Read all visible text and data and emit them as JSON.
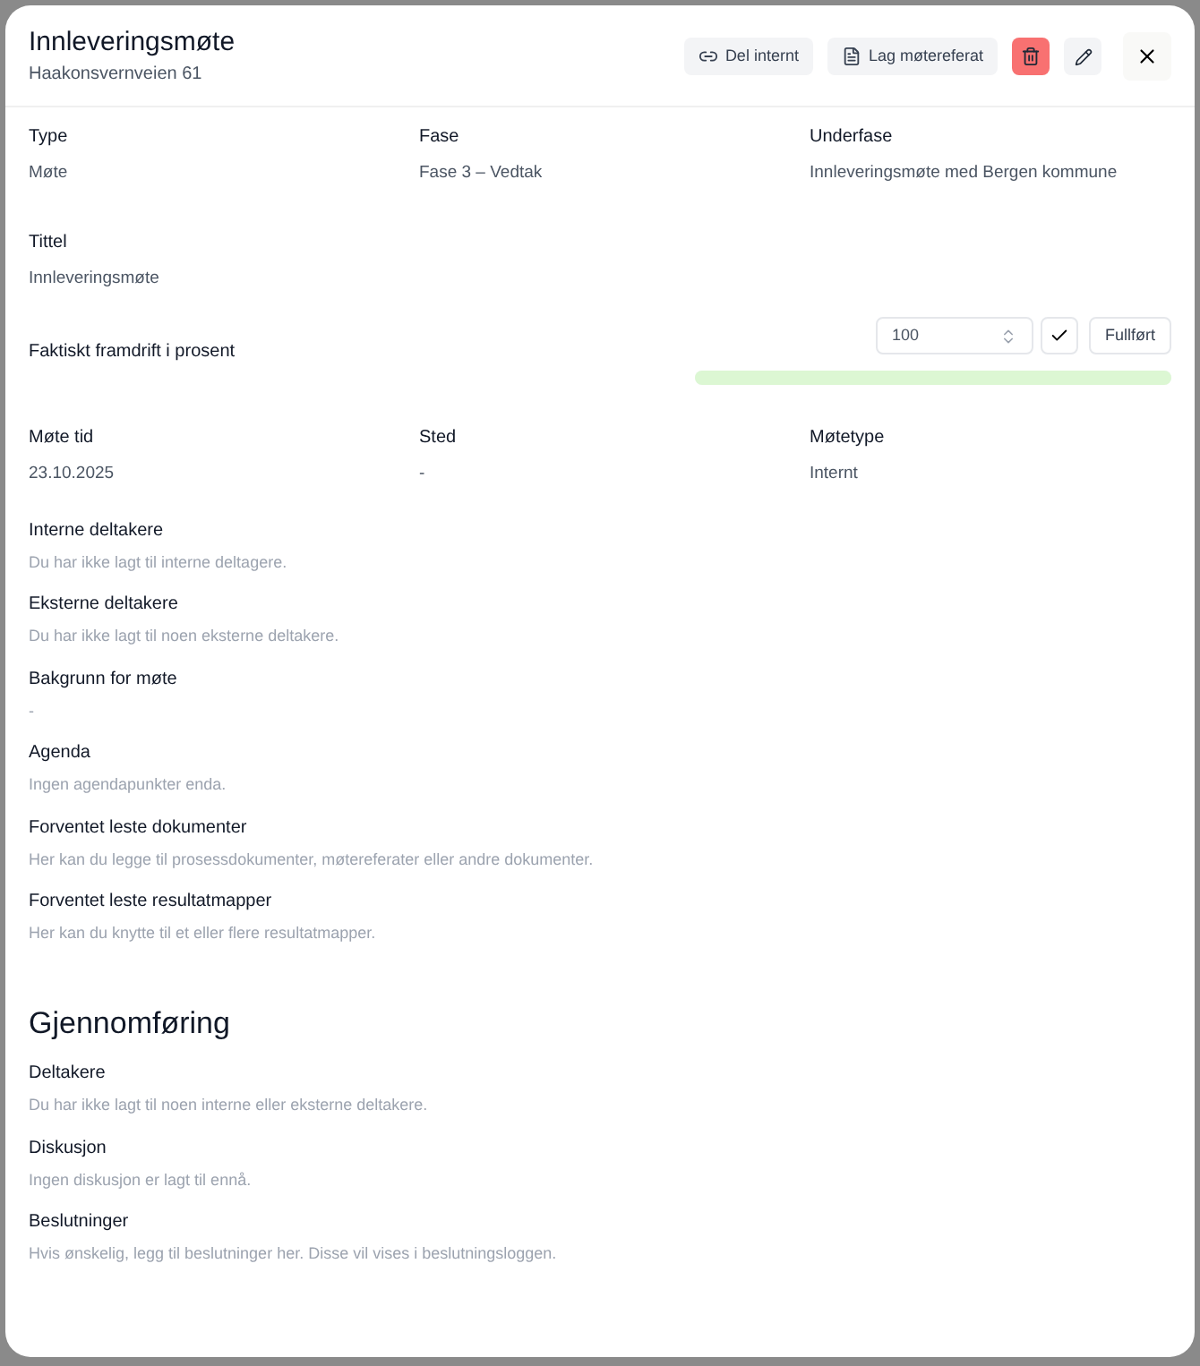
{
  "header": {
    "title": "Innleveringsmøte",
    "subtitle": "Haakonsvernveien 61"
  },
  "actions": [
    {
      "kind": "share",
      "label": "Del internt"
    },
    {
      "kind": "report",
      "label": "Lag møtereferat"
    },
    {
      "kind": "delete"
    },
    {
      "kind": "edit"
    },
    {
      "kind": "close"
    }
  ],
  "fields_top": [
    {
      "label": "Type",
      "value": "Møte"
    },
    {
      "label": "Fase",
      "value": "Fase 3 – Vedtak"
    },
    {
      "label": "Underfase",
      "value": "Innleveringsmøte med Bergen kommune"
    }
  ],
  "title_field": {
    "label": "Tittel",
    "value": "Innleveringsmøte"
  },
  "progress": {
    "label": "Faktiskt framdrift i prosent",
    "value": "100",
    "button": "Fullført",
    "level": 1.0
  },
  "fields_meeting": [
    {
      "label": "Møte tid",
      "value": "23.10.2025"
    },
    {
      "label": "Sted",
      "value": "-"
    },
    {
      "label": "Møtetype",
      "value": "Internt"
    }
  ],
  "sections": [
    {
      "label": "Interne deltakere",
      "text": "Du har ikke lagt til interne deltagere."
    },
    {
      "label": "Eksterne deltakere",
      "text": "Du har ikke lagt til noen eksterne deltakere."
    },
    {
      "label": "Bakgrunn for møte",
      "text": "-"
    },
    {
      "label": "Agenda",
      "text": "Ingen agendapunkter enda."
    },
    {
      "label": "Forventet leste dokumenter",
      "text": "Her kan du legge til prosessdokumenter, møtereferater eller andre dokumenter."
    },
    {
      "label": "Forventet leste resultatmapper",
      "text": "Her kan du knytte til et eller flere resultatmapper."
    }
  ],
  "execution": {
    "heading": "Gjennomføring",
    "sections": [
      {
        "label": "Deltakere",
        "text": "Du har ikke lagt til noen interne eller eksterne deltakere."
      },
      {
        "label": "Diskusjon",
        "text": "Ingen diskusjon er lagt til ennå."
      },
      {
        "label": "Beslutninger",
        "text": "Hvis ønskelig, legg til beslutninger her. Disse vil vises i beslutningsloggen."
      }
    ]
  }
}
